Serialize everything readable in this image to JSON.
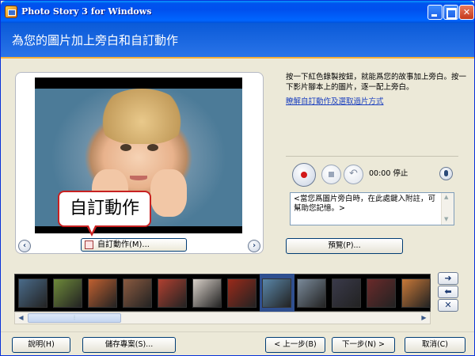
{
  "window": {
    "title": "Photo Story 3 for Windows"
  },
  "header": {
    "title": "為您的圖片加上旁白和自訂動作"
  },
  "preview": {
    "custom_motion_button": "自訂動作(M)...",
    "callout": "自訂動作",
    "prev_symbol": "‹",
    "next_symbol": "›"
  },
  "instructions": {
    "text": "按一下紅色錄製按鈕，就能爲您的故事加上旁白。按一下影片腳本上的圖片，逐一配上旁白。",
    "link": "瞭解自訂動作及選取過片方式"
  },
  "recorder": {
    "time": "00:00",
    "status": "停止",
    "undo_symbol": "↶"
  },
  "note": {
    "text": "<當您爲圖片旁白時，在此處鍵入附註，可幫助您記憶。>"
  },
  "buttons": {
    "preview": "預覽(P)...",
    "help": "說明(H)",
    "save_project": "儲存專案(S)...",
    "back": "< 上一步(B)",
    "next": "下一步(N) >",
    "cancel": "取消(C)"
  },
  "filmstrip": {
    "selected_index": 7,
    "thumbnail_colors": [
      "#4a6b8a",
      "#6e8a3a",
      "#c06030",
      "#8a5a40",
      "#b04030",
      "#d8d0c8",
      "#9a2a1a",
      "#5a86a8",
      "#7a8a9a",
      "#3a3a4a",
      "#6a2a2a",
      "#c87838"
    ],
    "side_symbols": [
      "➜",
      "⬅",
      "✕"
    ],
    "scroll_left": "◀",
    "scroll_right": "▶",
    "scroll_grip": "⦙"
  }
}
